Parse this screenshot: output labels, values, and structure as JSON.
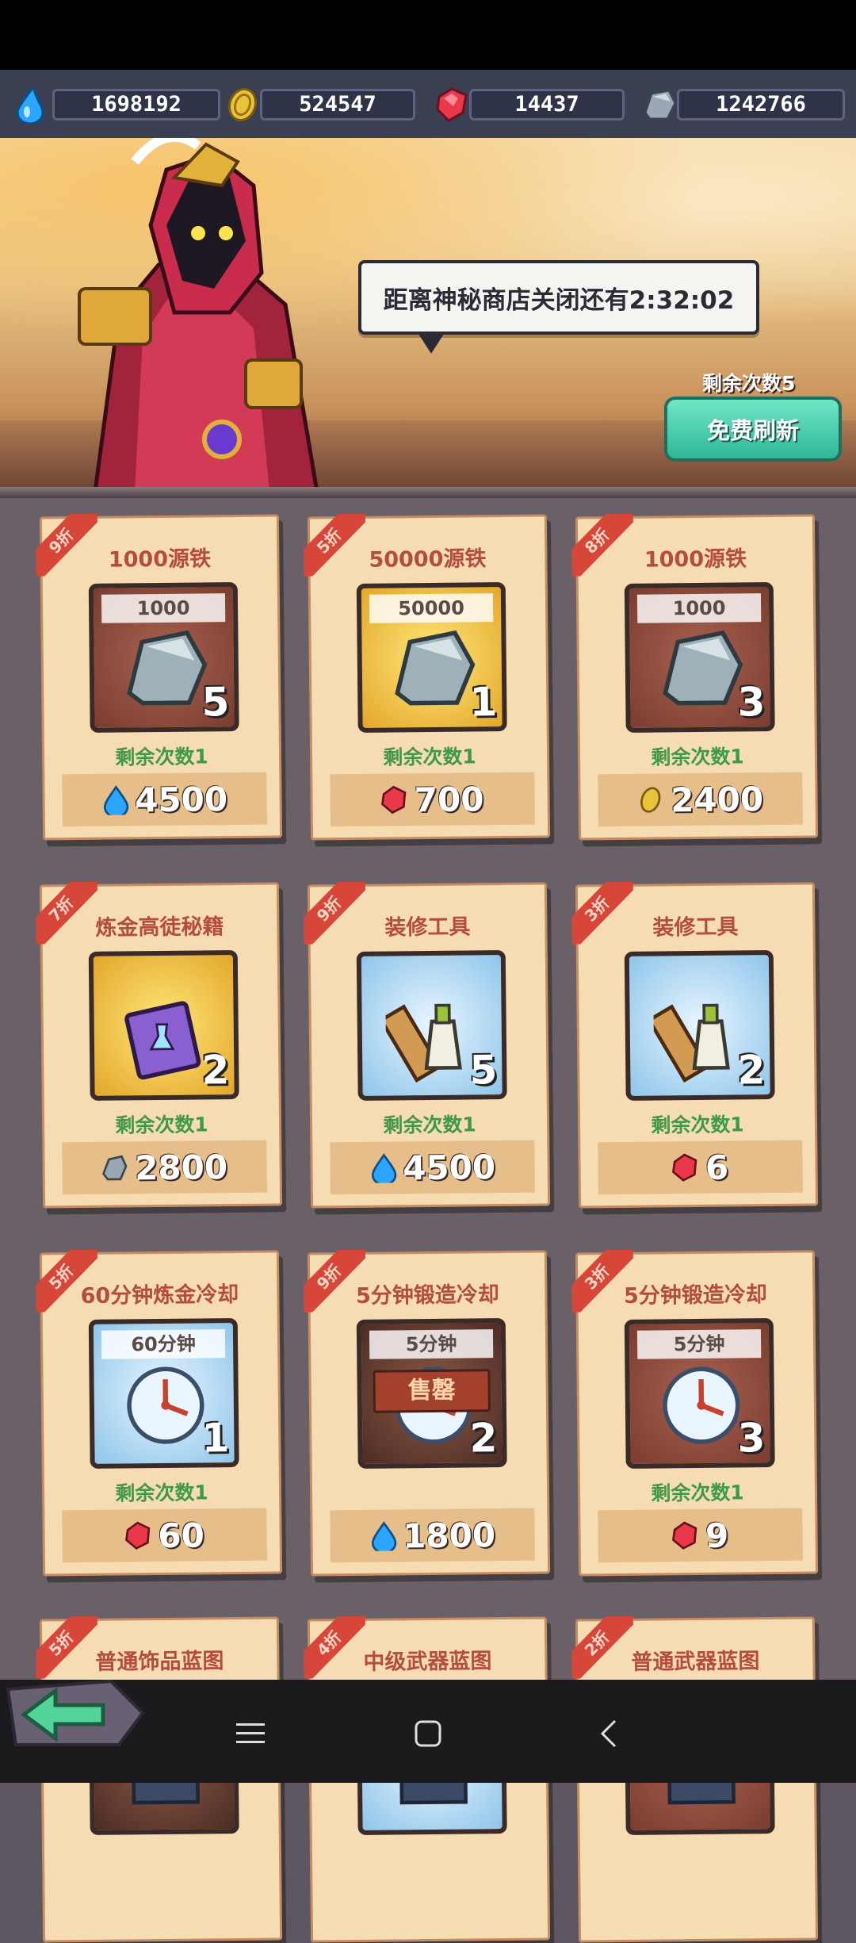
{
  "resources": [
    {
      "icon": "water-drop-icon",
      "value": "1698192"
    },
    {
      "icon": "gold-coin-icon",
      "value": "524547"
    },
    {
      "icon": "red-gem-icon",
      "value": "14437"
    },
    {
      "icon": "iron-ore-icon",
      "value": "1242766"
    }
  ],
  "banner": {
    "speech": "距离神秘商店关闭还有2:32:02",
    "refresh_count": "剩余次数5",
    "refresh_button": "免费刷新"
  },
  "items": [
    {
      "discount": "9折",
      "title": "1000源铁",
      "qty": "1000",
      "count": "5",
      "remain": "剩余次数1",
      "price": "4500",
      "currency": "water-drop-icon",
      "frame": "red",
      "art": "iron-ore-icon"
    },
    {
      "discount": "5折",
      "title": "50000源铁",
      "qty": "50000",
      "count": "1",
      "remain": "剩余次数1",
      "price": "700",
      "currency": "red-gem-icon",
      "frame": "gold",
      "art": "iron-ore-icon"
    },
    {
      "discount": "8折",
      "title": "1000源铁",
      "qty": "1000",
      "count": "3",
      "remain": "剩余次数1",
      "price": "2400",
      "currency": "gold-coin-icon",
      "frame": "red",
      "art": "iron-ore-icon"
    },
    {
      "discount": "7折",
      "title": "炼金高徒秘籍",
      "qty": "",
      "count": "2",
      "remain": "剩余次数1",
      "price": "2800",
      "currency": "iron-ore-icon",
      "frame": "gold",
      "art": "spellbook-icon"
    },
    {
      "discount": "9折",
      "title": "装修工具",
      "qty": "",
      "count": "5",
      "remain": "剩余次数1",
      "price": "4500",
      "currency": "water-drop-icon",
      "frame": "blue",
      "art": "repair-tools-icon"
    },
    {
      "discount": "3折",
      "title": "装修工具",
      "qty": "",
      "count": "2",
      "remain": "剩余次数1",
      "price": "6",
      "currency": "red-gem-icon",
      "frame": "blue",
      "art": "repair-tools-icon"
    },
    {
      "discount": "5折",
      "title": "60分钟炼金冷却",
      "qty": "60分钟",
      "count": "1",
      "remain": "剩余次数1",
      "price": "60",
      "currency": "red-gem-icon",
      "frame": "blue",
      "art": "clock-icon"
    },
    {
      "discount": "9折",
      "title": "5分钟锻造冷却",
      "qty": "5分钟",
      "count": "2",
      "remain": "",
      "price": "1800",
      "currency": "water-drop-icon",
      "frame": "dark",
      "art": "clock-icon",
      "sold_out": "售罄"
    },
    {
      "discount": "3折",
      "title": "5分钟锻造冷却",
      "qty": "5分钟",
      "count": "3",
      "remain": "剩余次数1",
      "price": "9",
      "currency": "red-gem-icon",
      "frame": "red",
      "art": "clock-icon"
    },
    {
      "discount": "5折",
      "title": "普通饰品蓝图",
      "qty": "",
      "count": "",
      "remain": "",
      "price": "",
      "currency": "",
      "frame": "dark",
      "art": "blueprint-icon"
    },
    {
      "discount": "4折",
      "title": "中级武器蓝图",
      "qty": "",
      "count": "",
      "remain": "",
      "price": "",
      "currency": "",
      "frame": "blue",
      "art": "blueprint-icon"
    },
    {
      "discount": "2折",
      "title": "普通武器蓝图",
      "qty": "",
      "count": "",
      "remain": "",
      "price": "",
      "currency": "",
      "frame": "red",
      "art": "blueprint-icon"
    }
  ],
  "colors": {
    "accent_green": "#3d9a47",
    "ribbon_red": "#d8463a",
    "title_red": "#b44d3b",
    "button_teal": "#2fb697"
  }
}
